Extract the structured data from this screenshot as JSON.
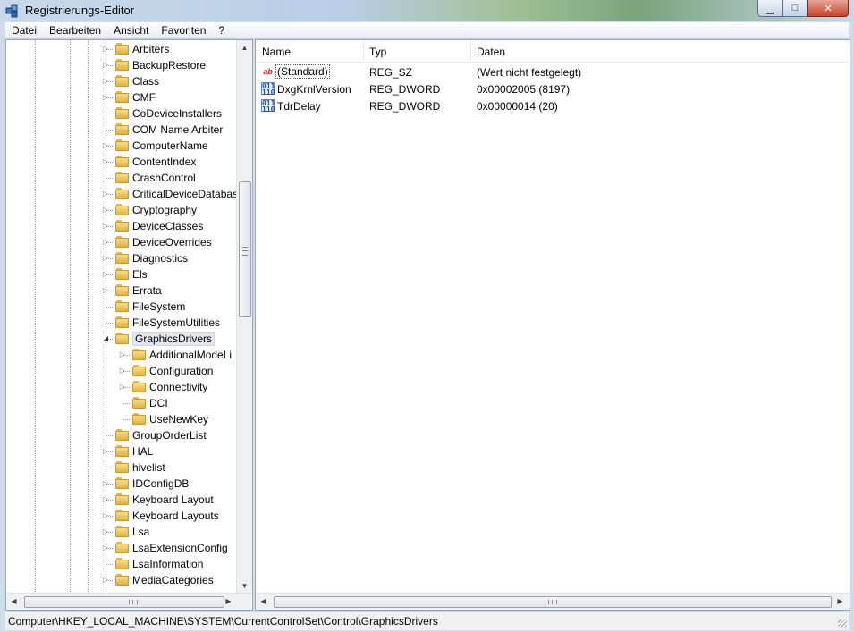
{
  "window": {
    "title": "Registrierungs-Editor",
    "controls": {
      "minimize": "▁",
      "maximize": "□",
      "close": "✕"
    }
  },
  "menu": [
    "Datei",
    "Bearbeiten",
    "Ansicht",
    "Favoriten",
    "?"
  ],
  "tree": {
    "items": [
      {
        "label": "Arbiters",
        "depth": 0,
        "expander": "▷"
      },
      {
        "label": "BackupRestore",
        "depth": 0,
        "expander": "▷"
      },
      {
        "label": "Class",
        "depth": 0,
        "expander": "▷"
      },
      {
        "label": "CMF",
        "depth": 0,
        "expander": "▷"
      },
      {
        "label": "CoDeviceInstallers",
        "depth": 0,
        "expander": ""
      },
      {
        "label": "COM Name Arbiter",
        "depth": 0,
        "expander": ""
      },
      {
        "label": "ComputerName",
        "depth": 0,
        "expander": "▷"
      },
      {
        "label": "ContentIndex",
        "depth": 0,
        "expander": "▷"
      },
      {
        "label": "CrashControl",
        "depth": 0,
        "expander": ""
      },
      {
        "label": "CriticalDeviceDatabas",
        "depth": 0,
        "expander": "▷"
      },
      {
        "label": "Cryptography",
        "depth": 0,
        "expander": "▷"
      },
      {
        "label": "DeviceClasses",
        "depth": 0,
        "expander": "▷"
      },
      {
        "label": "DeviceOverrides",
        "depth": 0,
        "expander": "▷"
      },
      {
        "label": "Diagnostics",
        "depth": 0,
        "expander": "▷"
      },
      {
        "label": "Els",
        "depth": 0,
        "expander": "▷"
      },
      {
        "label": "Errata",
        "depth": 0,
        "expander": "▷"
      },
      {
        "label": "FileSystem",
        "depth": 0,
        "expander": ""
      },
      {
        "label": "FileSystemUtilities",
        "depth": 0,
        "expander": ""
      },
      {
        "label": "GraphicsDrivers",
        "depth": 0,
        "expander": "◢",
        "selected": true
      },
      {
        "label": "AdditionalModeLi",
        "depth": 1,
        "expander": "▷"
      },
      {
        "label": "Configuration",
        "depth": 1,
        "expander": "▷"
      },
      {
        "label": "Connectivity",
        "depth": 1,
        "expander": "▷"
      },
      {
        "label": "DCI",
        "depth": 1,
        "expander": ""
      },
      {
        "label": "UseNewKey",
        "depth": 1,
        "expander": ""
      },
      {
        "label": "GroupOrderList",
        "depth": 0,
        "expander": ""
      },
      {
        "label": "HAL",
        "depth": 0,
        "expander": "▷"
      },
      {
        "label": "hivelist",
        "depth": 0,
        "expander": ""
      },
      {
        "label": "IDConfigDB",
        "depth": 0,
        "expander": "▷"
      },
      {
        "label": "Keyboard Layout",
        "depth": 0,
        "expander": "▷"
      },
      {
        "label": "Keyboard Layouts",
        "depth": 0,
        "expander": "▷"
      },
      {
        "label": "Lsa",
        "depth": 0,
        "expander": "▷"
      },
      {
        "label": "LsaExtensionConfig",
        "depth": 0,
        "expander": "▷"
      },
      {
        "label": "LsaInformation",
        "depth": 0,
        "expander": ""
      },
      {
        "label": "MediaCategories",
        "depth": 0,
        "expander": "▷"
      }
    ]
  },
  "scroll": {
    "up": "▲",
    "down": "▼",
    "left": "◀",
    "right": "▶"
  },
  "values": {
    "columns": [
      "Name",
      "Typ",
      "Daten"
    ],
    "rows": [
      {
        "name": "(Standard)",
        "type": "REG_SZ",
        "data": "(Wert nicht festgelegt)",
        "icon": "ab",
        "icon_name": "string-value-icon"
      },
      {
        "name": "DxgKrnlVersion",
        "type": "REG_DWORD",
        "data": "0x00002005 (8197)",
        "icon": "011 110",
        "icon_name": "binary-value-icon"
      },
      {
        "name": "TdrDelay",
        "type": "REG_DWORD",
        "data": "0x00000014 (20)",
        "icon": "011 110",
        "icon_name": "binary-value-icon"
      }
    ]
  },
  "statusbar": {
    "path": "Computer\\HKEY_LOCAL_MACHINE\\SYSTEM\\CurrentControlSet\\Control\\GraphicsDrivers"
  }
}
